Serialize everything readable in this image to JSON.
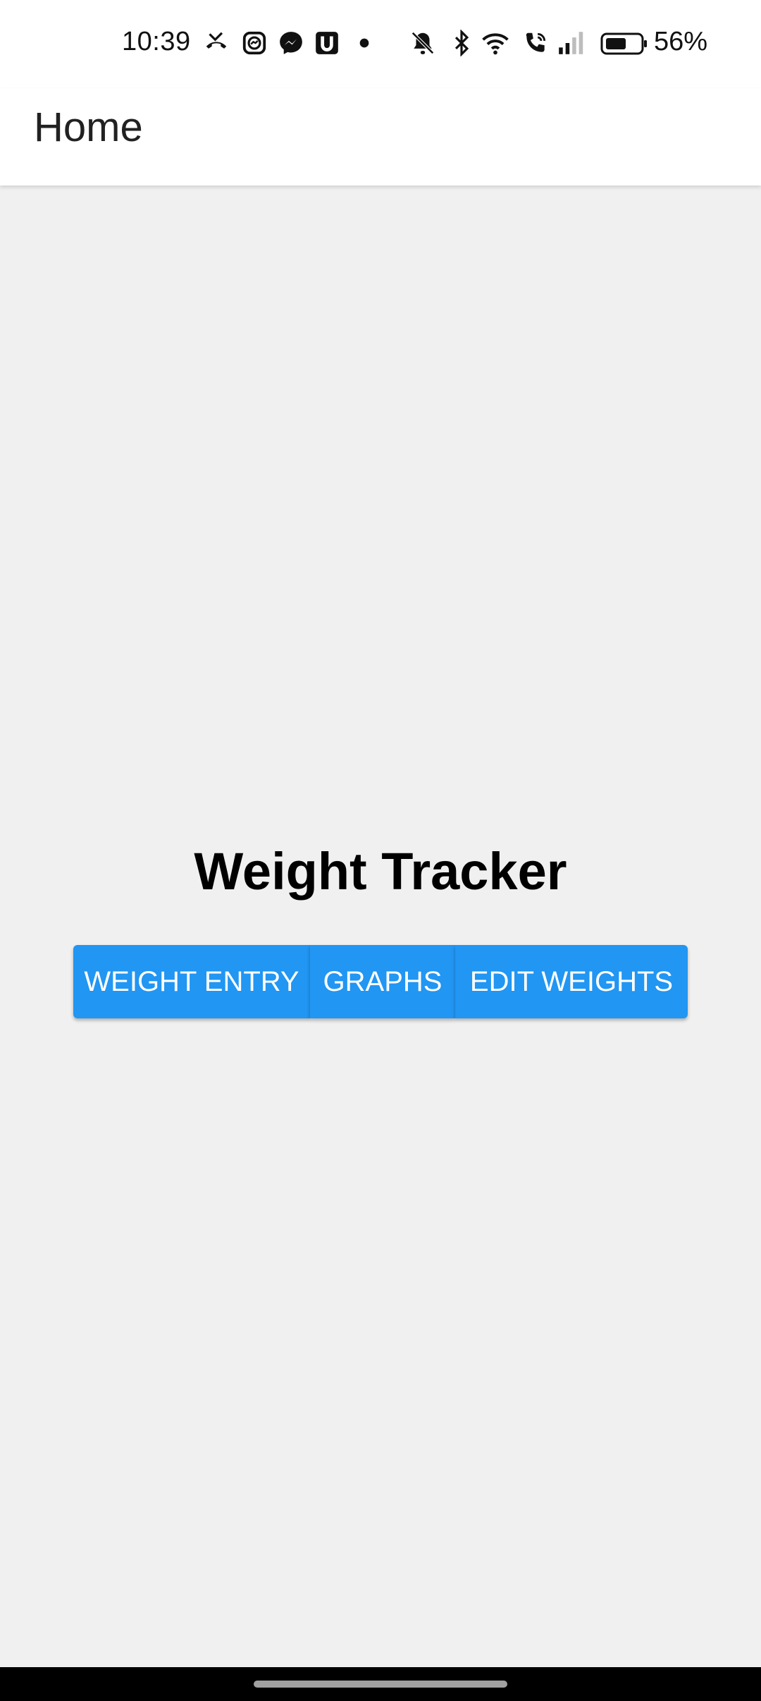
{
  "status_bar": {
    "time": "10:39",
    "battery_percent": "56%",
    "icons": [
      "missed-call-icon",
      "messenger-chat-icon",
      "messenger-icon",
      "u-app-icon",
      "dot-icon",
      "silent-icon",
      "bluetooth-icon",
      "wifi-icon",
      "wifi-call-icon",
      "signal-icon",
      "battery-icon"
    ]
  },
  "app_bar": {
    "title": "Home"
  },
  "main": {
    "headline": "Weight Tracker",
    "buttons": [
      {
        "label": "WEIGHT ENTRY"
      },
      {
        "label": "GRAPHS"
      },
      {
        "label": "EDIT WEIGHTS"
      }
    ]
  },
  "colors": {
    "primary": "#2196f3",
    "background": "#f0f0f0",
    "app_bar": "#ffffff",
    "nav_bar": "#000000"
  }
}
